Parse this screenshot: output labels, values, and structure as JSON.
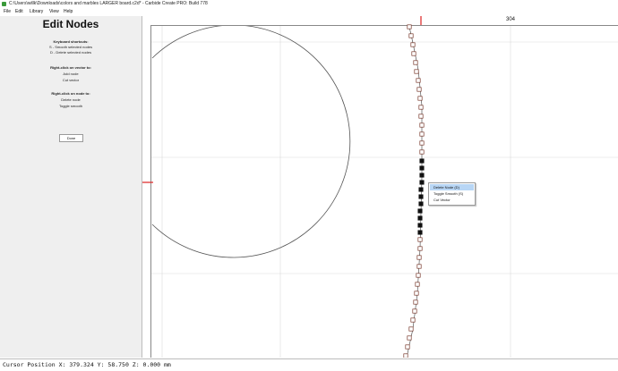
{
  "window": {
    "title": "C:\\Users\\willk\\Downloads\\colors and marbles LARGER board.c2d* - Carbide Create PRO: Build 778"
  },
  "menu": [
    "File",
    "Edit",
    "Library",
    "View",
    "Help"
  ],
  "panel": {
    "title": "Edit Nodes",
    "keyboard_heading": "Keyboard shortcuts:",
    "keyboard_lines": [
      "S - Smooth selected nodes",
      "D - Delete selected nodes"
    ],
    "vector_heading": "Right-click on vector to:",
    "vector_lines": [
      "Add node",
      "Cut vector"
    ],
    "node_heading": "Right-click on node to:",
    "node_lines": [
      "Delete node",
      "Toggle smooth"
    ],
    "done_label": "Done"
  },
  "ruler": {
    "top_label": "304"
  },
  "context_menu": {
    "items": [
      "Delete Node (D)",
      "Toggle Smooth (S)",
      "Cut Vector"
    ],
    "highlighted_index": 0
  },
  "status": {
    "text": "Cursor Position X: 379.324 Y: 58.750 Z: 0.000 mm"
  },
  "colors": {
    "marker_red": "#dd2222",
    "highlight": "#b8d6f5",
    "panel_bg": "#efefef",
    "node_outline": "#7a3b2e"
  },
  "icons": {
    "app": "carbide-create-icon"
  }
}
